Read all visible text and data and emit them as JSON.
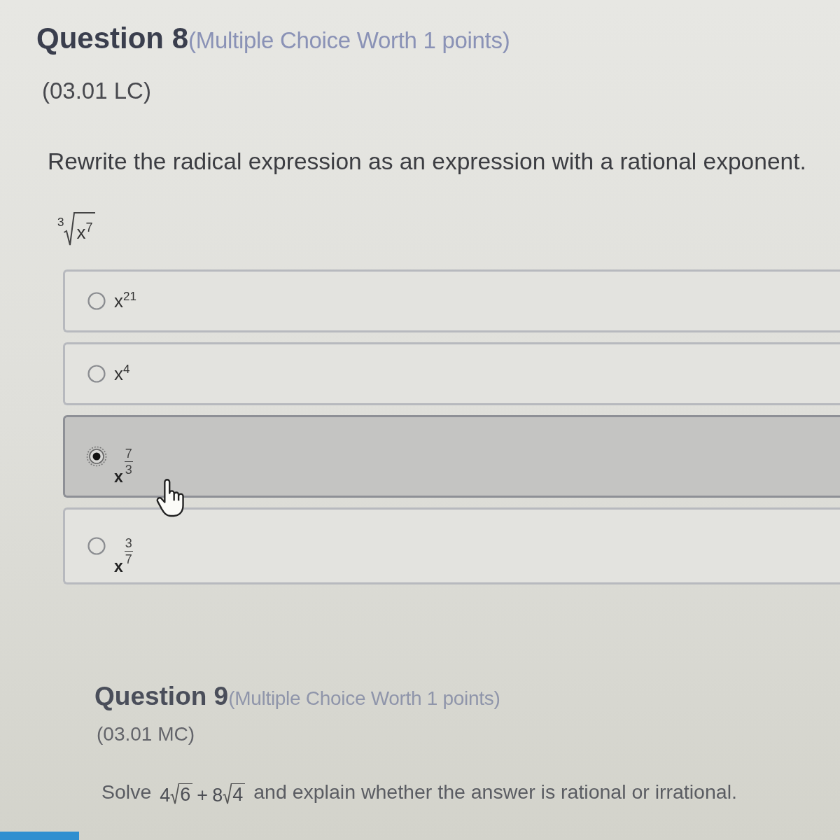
{
  "questions": [
    {
      "title": "Question 8",
      "meta": "(Multiple Choice Worth 1 points)",
      "code": "(03.01 LC)",
      "prompt": [
        {
          "kind": "text",
          "text": "Rewrite the radical expression as an expression with a rational exponent."
        }
      ],
      "expression": {
        "kind": "root",
        "index": "3",
        "radicand": "x$^{7}$"
      },
      "options": [
        {
          "kind": "power",
          "label": "x$^{21}$",
          "selected": false
        },
        {
          "kind": "power",
          "label": "x$^{4}$",
          "selected": false
        },
        {
          "kind": "fraction_power",
          "base": "x",
          "numerator": "7",
          "denominator": "3",
          "selected": true
        },
        {
          "kind": "fraction_power",
          "base": "x",
          "numerator": "3",
          "denominator": "7",
          "selected": false
        }
      ]
    },
    {
      "title": "Question 9",
      "meta": "(Multiple Choice Worth 1 points)",
      "code": "(03.01 MC)",
      "prompt": [
        {
          "kind": "text",
          "text": "Solve"
        },
        {
          "kind": "radical_sum",
          "terms": [
            {
              "coefficient": "4",
              "radicand": "6"
            },
            {
              "operator": "+",
              "coefficient": "8",
              "radicand": "4"
            }
          ]
        },
        {
          "kind": "text",
          "text": "and explain whether the answer is rational or irrational."
        }
      ]
    }
  ]
}
